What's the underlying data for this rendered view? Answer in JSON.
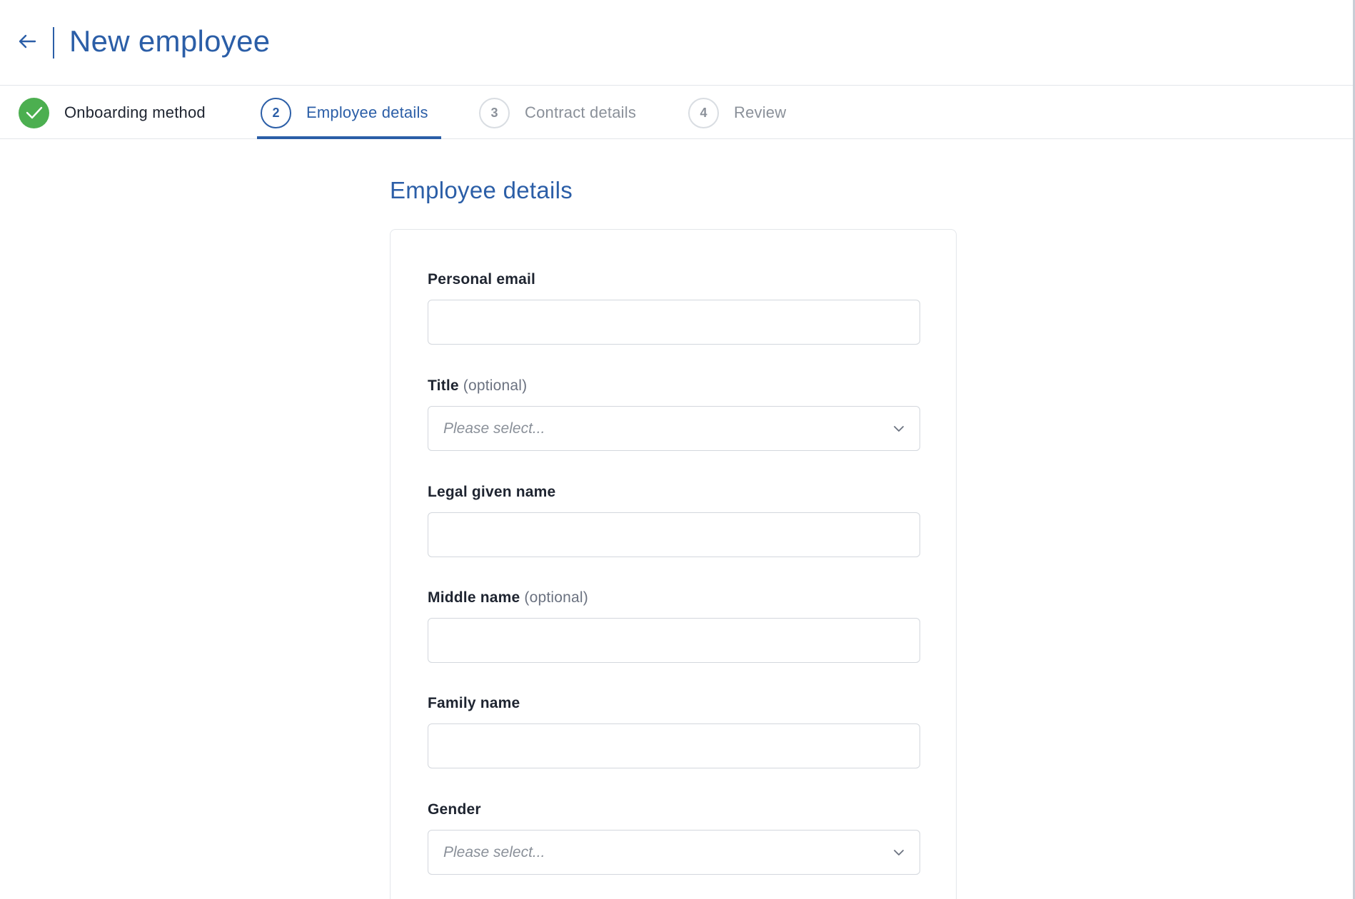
{
  "header": {
    "title": "New employee",
    "back_icon": "arrow-left-icon"
  },
  "stepper": {
    "steps": [
      {
        "number": "1",
        "label": "Onboarding method",
        "state": "done"
      },
      {
        "number": "2",
        "label": "Employee details",
        "state": "active"
      },
      {
        "number": "3",
        "label": "Contract details",
        "state": "pending"
      },
      {
        "number": "4",
        "label": "Review",
        "state": "pending"
      }
    ]
  },
  "section": {
    "title": "Employee details"
  },
  "form": {
    "personal_email": {
      "label": "Personal email",
      "value": ""
    },
    "title": {
      "label": "Title",
      "optional": "(optional)",
      "placeholder": "Please select..."
    },
    "legal_given_name": {
      "label": "Legal given name",
      "value": ""
    },
    "middle_name": {
      "label": "Middle name",
      "optional": "(optional)",
      "value": ""
    },
    "family_name": {
      "label": "Family name",
      "value": ""
    },
    "gender": {
      "label": "Gender",
      "placeholder": "Please select..."
    }
  },
  "colors": {
    "accent": "#2b5ea7",
    "success": "#4caf50",
    "muted": "#8a9099",
    "border": "#d3d7dd"
  }
}
